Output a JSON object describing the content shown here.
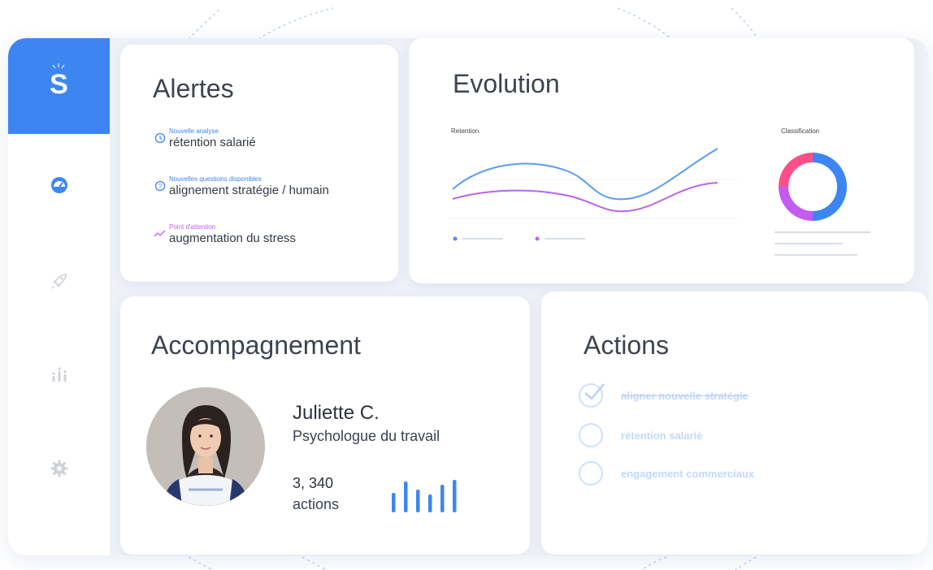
{
  "brand": {
    "logo_letter": "S",
    "accent": "#3d86f2"
  },
  "sidebar": {
    "items": [
      {
        "icon": "dashboard-gauge-icon",
        "active": true
      },
      {
        "icon": "rocket-icon",
        "active": false
      },
      {
        "icon": "bar-stats-icon",
        "active": false
      },
      {
        "icon": "gear-icon",
        "active": false
      }
    ]
  },
  "alertes": {
    "title": "Alertes",
    "items": [
      {
        "tag": "Nouvelle analyse",
        "text": "rétention salarié",
        "icon": "clock-icon",
        "color": "#3d86f2"
      },
      {
        "tag": "Nouvelles questions disponibles",
        "text": "alignement stratégie / humain",
        "icon": "question-icon",
        "color": "#3d86f2"
      },
      {
        "tag": "Point d'attention",
        "text": "augmentation du stress",
        "icon": "trend-icon",
        "color": "#c35bf0"
      }
    ]
  },
  "evolution": {
    "title": "Evolution",
    "retention_label": "Retention",
    "classification_label": "Classification",
    "line_colors": [
      "#4a90f0",
      "#b964ee"
    ],
    "donut_colors": [
      "#3d86f2",
      "#c35bf0",
      "#ff4f8b"
    ]
  },
  "accompagnement": {
    "title": "Accompagnement",
    "name": "Juliette C.",
    "role": "Psychologue du travail",
    "stat_value": "3, 340",
    "stat_label": "actions"
  },
  "actions": {
    "title": "Actions",
    "items": [
      {
        "label": "aligner nouvelle stratégie",
        "done": true
      },
      {
        "label": "rétention salarié",
        "done": false
      },
      {
        "label": "engagement commerciaux",
        "done": false
      }
    ]
  }
}
